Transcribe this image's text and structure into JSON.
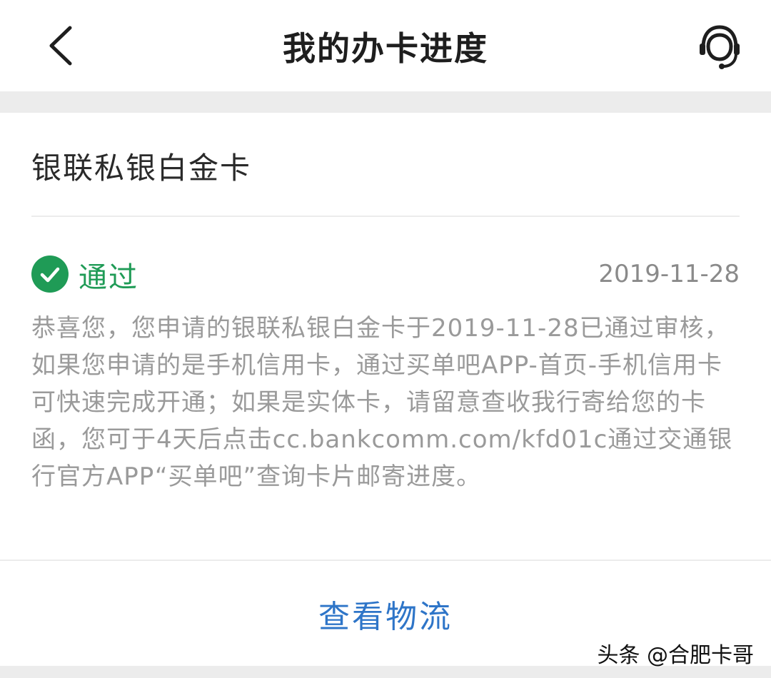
{
  "header": {
    "title": "我的办卡进度",
    "back_icon": "chevron-left-icon",
    "support_icon": "customer-service-headset-icon"
  },
  "card": {
    "name": "银联私银白金卡",
    "status": {
      "icon": "check-circle-icon",
      "label": "通过",
      "date": "2019-11-28",
      "color": "#1f9b56"
    },
    "message": "恭喜您，您申请的银联私银白金卡于2019-11-28已通过审核，如果您申请的是手机信用卡，通过买单吧APP-首页-手机信用卡可快速完成开通；如果是实体卡，请留意查收我行寄给您的卡函，您可于4天后点击cc.bankcomm.com/kfd01c通过交通银行官方APP“买单吧”查询卡片邮寄进度。"
  },
  "actions": {
    "track_label": "查看物流",
    "accent_color": "#2e75c8"
  },
  "watermark": "头条 @合肥卡哥"
}
